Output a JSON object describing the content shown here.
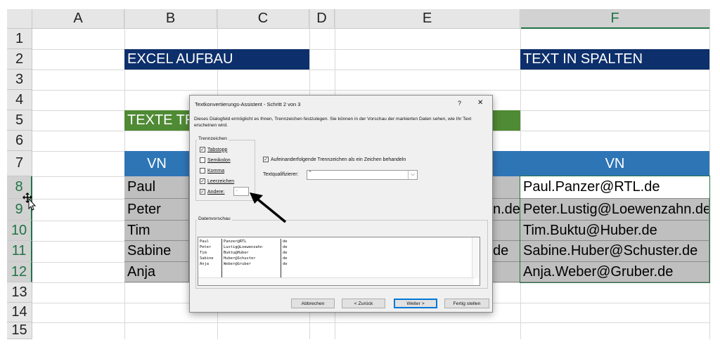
{
  "columns": [
    "A",
    "B",
    "C",
    "D",
    "E",
    "F"
  ],
  "rows": [
    "1",
    "2",
    "3",
    "4",
    "5",
    "6",
    "7",
    "8",
    "9",
    "10",
    "11",
    "12",
    "13",
    "14",
    "15"
  ],
  "cells": {
    "b2": "EXCEL AUFBAU",
    "f2": "TEXT IN SPALTEN",
    "b5": "TEXTE TR",
    "b7": "VN",
    "f7": "VN",
    "b_names": [
      "Paul",
      "Peter",
      "Tim",
      "Sabine",
      "Anja"
    ],
    "e9_frag": "n.de",
    "e11_frag": "de",
    "f_emails": [
      "Paul.Panzer@RTL.de",
      "Peter.Lustig@Loewenzahn.de",
      "Tim.Buktu@Huber.de",
      "Sabine.Huber@Schuster.de",
      "Anja.Weber@Gruber.de"
    ]
  },
  "dialog": {
    "title": "Textkonvertierungs-Assistent - Schritt 2 von 3",
    "help": "?",
    "close": "✕",
    "description": "Dieses Dialogfeld ermöglicht es Ihnen, Trennzeichen festzulegen. Sie können in der Vorschau der markierten Daten sehen, wie Ihr Text erscheinen wird.",
    "delimiters_group": "Trennzeichen",
    "delimiters": [
      {
        "label": "Tabstopp",
        "checked": true
      },
      {
        "label": "Semikolon",
        "checked": false
      },
      {
        "label": "Komma",
        "checked": false
      },
      {
        "label": "Leerzeichen",
        "checked": true
      },
      {
        "label": "Andere:",
        "checked": true
      }
    ],
    "other_value": ".",
    "consecutive_label": "Aufeinanderfolgende Trennzeichen als ein Zeichen behandeln",
    "consecutive_checked": true,
    "qualifier_label": "Textqualifizierer:",
    "qualifier_value": "\"",
    "preview_group": "Datenvorschau",
    "preview_rows": [
      [
        "Paul",
        "Panzer@RTL",
        "de"
      ],
      [
        "Peter",
        "Lustig@Loewenzahn",
        "de"
      ],
      [
        "Tim",
        "Buktu@Huber",
        "de"
      ],
      [
        "Sabine",
        "Huber@Schuster",
        "de"
      ],
      [
        "Anja",
        "Weber@Gruber",
        "de"
      ]
    ],
    "buttons": {
      "cancel": "Abbrechen",
      "back": "< Zurück",
      "next": "Weiter >",
      "finish": "Fertig stellen"
    }
  },
  "colors": {
    "navy": "#0d2f6b",
    "green": "#4f8a34",
    "blue": "#2e75b6",
    "selection": "#217346"
  }
}
